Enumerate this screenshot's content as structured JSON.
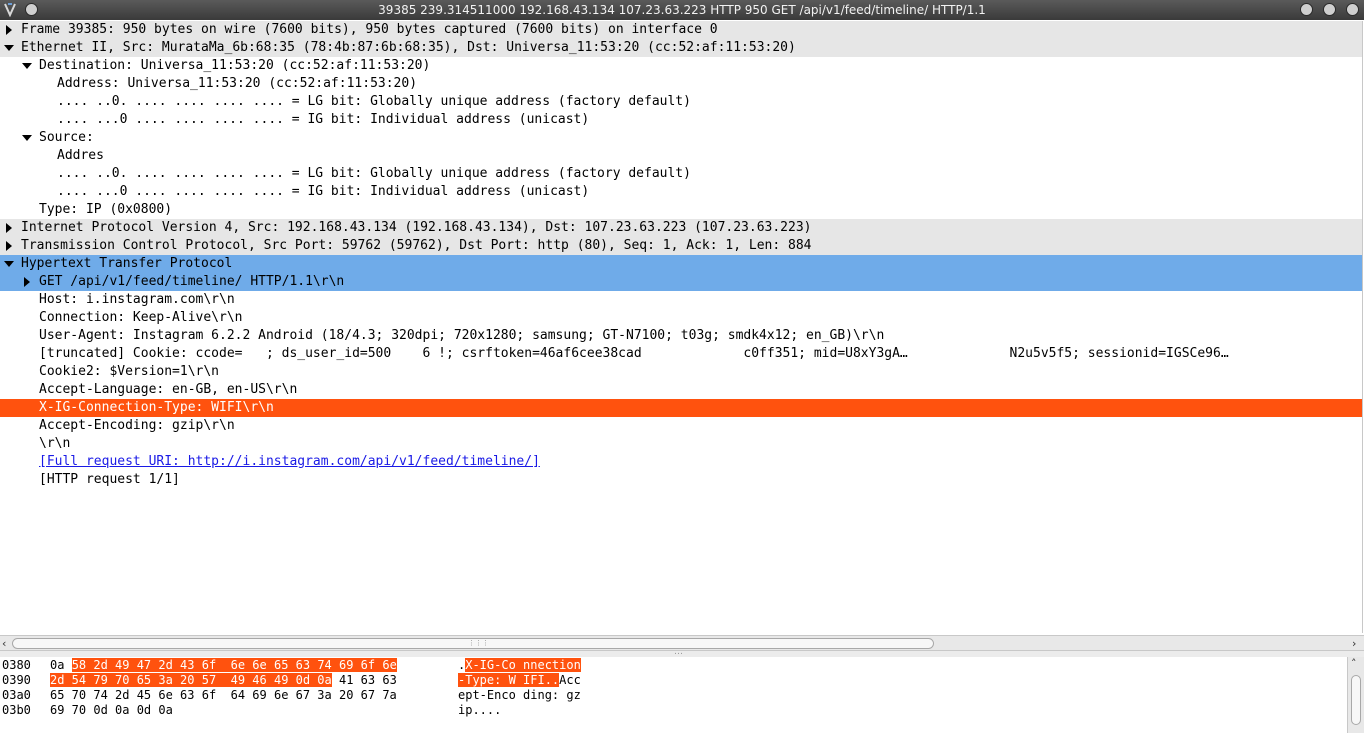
{
  "window": {
    "title": "39385 239.314511000 192.168.43.134 107.23.63.223 HTTP 950 GET /api/v1/feed/timeline/ HTTP/1.1"
  },
  "tree": {
    "rows": [
      {
        "text": "Frame 39385: 950 bytes on wire (7600 bits), 950 bytes captured (7600 bits) on interface 0",
        "state": "collapsed",
        "level": 0,
        "style": "proto"
      },
      {
        "text": "Ethernet II, Src: MurataMa_6b:68:35 (78:4b:87:6b:68:35), Dst: Universa_11:53:20 (cc:52:af:11:53:20)",
        "state": "expanded",
        "level": 0,
        "style": "proto"
      },
      {
        "text": "Destination: Universa_11:53:20 (cc:52:af:11:53:20)",
        "state": "expanded",
        "level": 1,
        "style": "plain"
      },
      {
        "text": "Address: Universa_11:53:20 (cc:52:af:11:53:20)",
        "state": "none",
        "level": 2,
        "style": "plain"
      },
      {
        "text": ".... ..0. .... .... .... .... = LG bit: Globally unique address (factory default)",
        "state": "none",
        "level": 2,
        "style": "plain"
      },
      {
        "text": ".... ...0 .... .... .... .... = IG bit: Individual address (unicast)",
        "state": "none",
        "level": 2,
        "style": "plain"
      },
      {
        "text": "Source:",
        "state": "expanded",
        "level": 1,
        "style": "plain"
      },
      {
        "text": "Addres",
        "state": "none",
        "level": 2,
        "style": "plain"
      },
      {
        "text": ".... ..0. .... .... .... .... = LG bit: Globally unique address (factory default)",
        "state": "none",
        "level": 2,
        "style": "plain"
      },
      {
        "text": ".... ...0 .... .... .... .... = IG bit: Individual address (unicast)",
        "state": "none",
        "level": 2,
        "style": "plain"
      },
      {
        "text": "Type: IP (0x0800)",
        "state": "none",
        "level": 1,
        "style": "plain"
      },
      {
        "text": "Internet Protocol Version 4, Src: 192.168.43.134 (192.168.43.134), Dst: 107.23.63.223 (107.23.63.223)",
        "state": "collapsed",
        "level": 0,
        "style": "proto"
      },
      {
        "text": "Transmission Control Protocol, Src Port: 59762 (59762), Dst Port: http (80), Seq: 1, Ack: 1, Len: 884",
        "state": "collapsed",
        "level": 0,
        "style": "proto"
      },
      {
        "text": "Hypertext Transfer Protocol",
        "state": "expanded",
        "level": 0,
        "style": "sel"
      },
      {
        "text": "GET /api/v1/feed/timeline/ HTTP/1.1\\r\\n",
        "state": "collapsed",
        "level": 1,
        "style": "sel"
      },
      {
        "text": "Host: i.instagram.com\\r\\n",
        "state": "none",
        "level": 1,
        "style": "plain"
      },
      {
        "text": "Connection: Keep-Alive\\r\\n",
        "state": "none",
        "level": 1,
        "style": "plain"
      },
      {
        "text": "User-Agent: Instagram 6.2.2 Android (18/4.3; 320dpi; 720x1280; samsung; GT-N7100; t03g; smdk4x12; en_GB)\\r\\n",
        "state": "none",
        "level": 1,
        "style": "plain"
      },
      {
        "text": "[truncated] Cookie: ccode=   ; ds_user_id=500    6 !; csrftoken=46af6cee38cad             c0ff351; mid=U8xY3gA…             N2u5v5f5; sessionid=IGSCe96…                  dc9b",
        "state": "none",
        "level": 1,
        "style": "plain"
      },
      {
        "text": "Cookie2: $Version=1\\r\\n",
        "state": "none",
        "level": 1,
        "style": "plain"
      },
      {
        "text": "Accept-Language: en-GB, en-US\\r\\n",
        "state": "none",
        "level": 1,
        "style": "plain"
      },
      {
        "text": "X-IG-Connection-Type: WIFI\\r\\n",
        "state": "none",
        "level": 1,
        "style": "hl"
      },
      {
        "text": "Accept-Encoding: gzip\\r\\n",
        "state": "none",
        "level": 1,
        "style": "plain"
      },
      {
        "text": "\\r\\n",
        "state": "none",
        "level": 1,
        "style": "plain"
      },
      {
        "text": "[Full request URI: http://i.instagram.com/api/v1/feed/timeline/]",
        "state": "none",
        "level": 1,
        "style": "link"
      },
      {
        "text": "[HTTP request 1/1]",
        "state": "none",
        "level": 1,
        "style": "plain"
      }
    ]
  },
  "bytes": {
    "rows": [
      {
        "offset": "0380",
        "hex_pre": "0a ",
        "hex_hl": "58 2d 49 47 2d 43 6f  6e 6e 65 63 74 69 6f 6e",
        "hex_post": "",
        "ascii_pre": ".",
        "ascii_hl": "X-IG-Co nnection",
        "ascii_post": ""
      },
      {
        "offset": "0390",
        "hex_pre": "",
        "hex_hl": "2d 54 79 70 65 3a 20 57  49 46 49 0d 0a",
        "hex_post": " 41 63 63",
        "ascii_pre": "",
        "ascii_hl": "-Type: W IFI..",
        "ascii_post": "Acc"
      },
      {
        "offset": "03a0",
        "hex_pre": "65 70 74 2d 45 6e 63 6f  64 69 6e 67 3a 20 67 7a",
        "hex_hl": "",
        "hex_post": "",
        "ascii_pre": "ept-Enco ding: gz",
        "ascii_hl": "",
        "ascii_post": ""
      },
      {
        "offset": "03b0",
        "hex_pre": "69 70 0d 0a 0d 0a",
        "hex_hl": "",
        "hex_post": "",
        "ascii_pre": "ip....",
        "ascii_hl": "",
        "ascii_post": ""
      }
    ]
  },
  "colors": {
    "selected_row": "#6fabe9",
    "highlight_row": "#ff520e",
    "protocol_row": "#e6e6e6"
  }
}
